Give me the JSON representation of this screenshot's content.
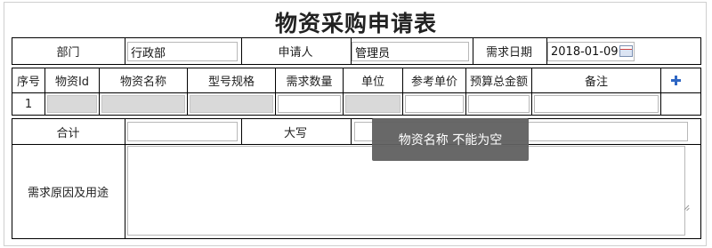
{
  "page": {
    "title": "物资采购申请表"
  },
  "header_row": {
    "department_label": "部门",
    "department_value": "行政部",
    "applicant_label": "申请人",
    "applicant_value": "管理员",
    "date_label": "需求日期",
    "date_value": "2018-01-09"
  },
  "items_table": {
    "columns": [
      "序号",
      "物资Id",
      "物资名称",
      "型号规格",
      "需求数量",
      "单位",
      "参考单价",
      "预算总金额",
      "备注"
    ],
    "rows": [
      {
        "index": "1",
        "material_id": "",
        "material_name": "",
        "spec": "",
        "quantity": "",
        "unit": "",
        "unit_price": "",
        "total_budget": "",
        "remark": ""
      }
    ],
    "add_icon": "plus-icon"
  },
  "totals_row": {
    "total_label": "合计",
    "total_value": "",
    "capital_label": "大写",
    "capital_value": ""
  },
  "reason_row": {
    "label": "需求原因及用途",
    "value": ""
  },
  "toast": {
    "message": "物资名称 不能为空"
  },
  "colors": {
    "toast_bg": "#5f5f5f",
    "plus_icon": "#2f67c4",
    "readonly_field": "#d9d9d9"
  }
}
